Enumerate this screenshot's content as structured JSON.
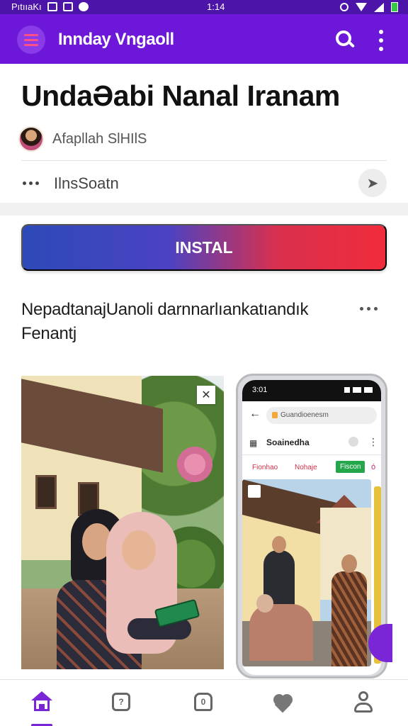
{
  "status_bar": {
    "carrier": "PıtııaKı",
    "time": "1:14",
    "battery_color": "#33cc44"
  },
  "app_bar": {
    "title": "Inndaу Vngaoll",
    "background": "#6d18d8",
    "icons": [
      "menu-logo-icon",
      "search-icon",
      "more-vertical-icon"
    ]
  },
  "article": {
    "title": "UndaƏabi Nanal Iranam",
    "author": "Afapllah SlHIlS",
    "section_label": "IlnsSoatn",
    "install_label": "INSTAL",
    "description": "NepadtanajUanoli darnnarlıankatıandık Fenantj"
  },
  "phone_mockup": {
    "time": "3:01",
    "url": "Guandioenesm",
    "toolbar_title": "Soainedha",
    "tabs": [
      "Fionhao",
      "Nohaje",
      "Fiscon",
      "ó"
    ]
  },
  "bottom_nav": {
    "items": [
      "home",
      "messages",
      "library",
      "favorites",
      "profile"
    ],
    "active": "home",
    "accent": "#7a25d6"
  }
}
